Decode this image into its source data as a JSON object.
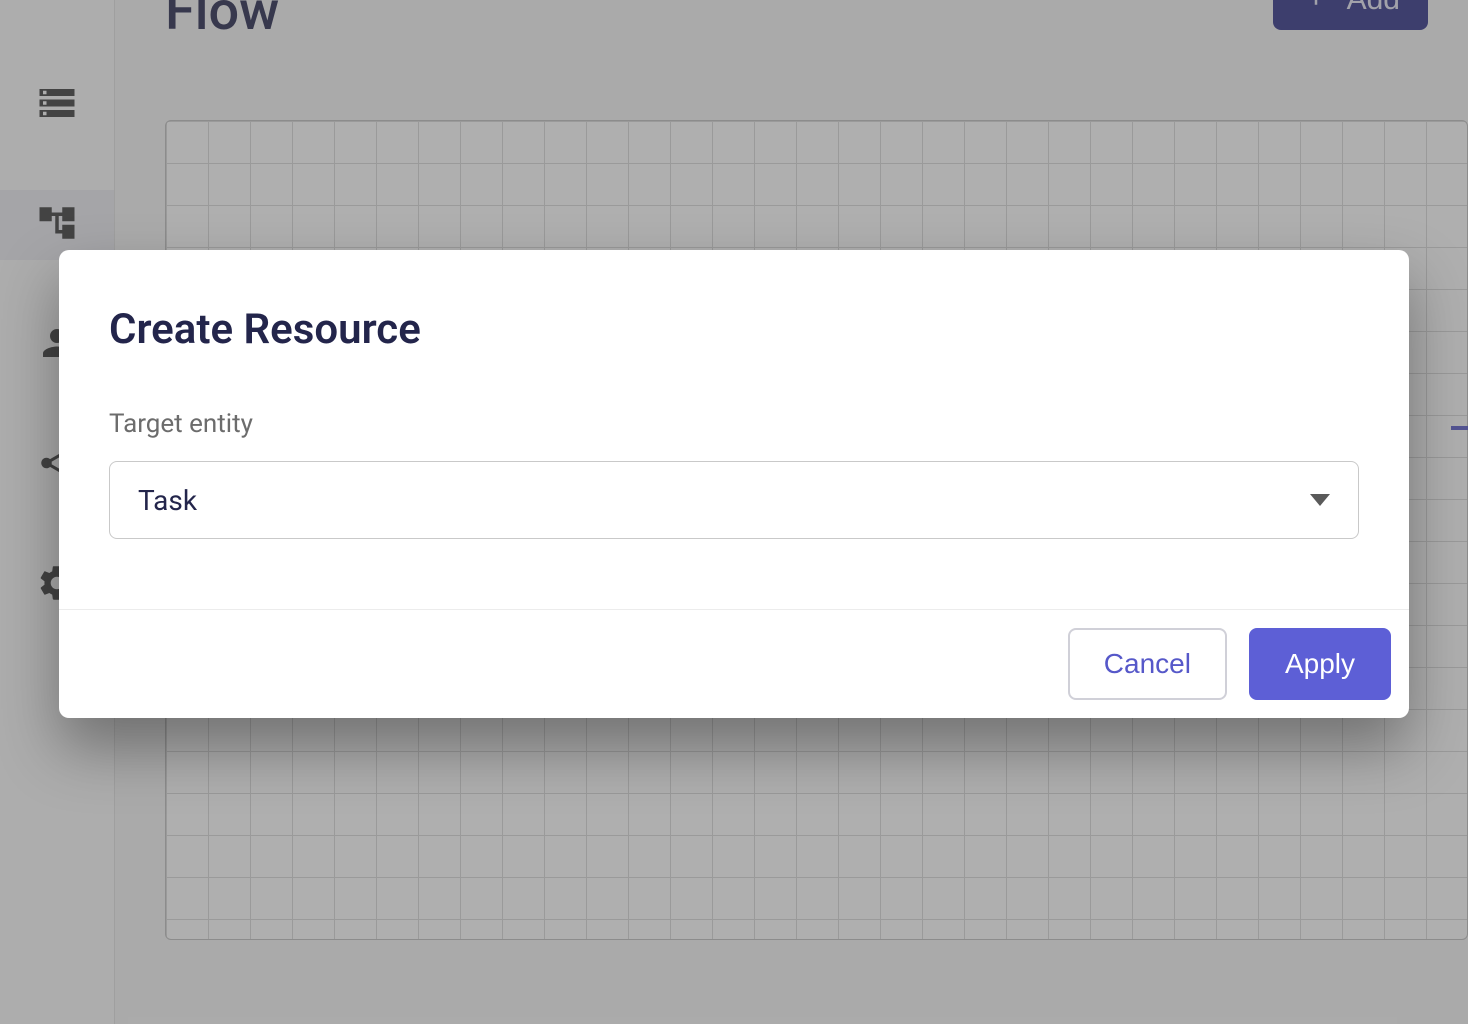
{
  "page": {
    "title": "Flow",
    "add_button_label": "Add"
  },
  "sidebar": {
    "items": [
      {
        "icon": "storage-icon"
      },
      {
        "icon": "flow-tree-icon",
        "active": true
      },
      {
        "icon": "users-group-icon"
      },
      {
        "icon": "share-nodes-icon"
      },
      {
        "icon": "gear-icon"
      }
    ]
  },
  "modal": {
    "title": "Create Resource",
    "field_label": "Target entity",
    "select_value": "Task",
    "cancel_label": "Cancel",
    "apply_label": "Apply"
  }
}
